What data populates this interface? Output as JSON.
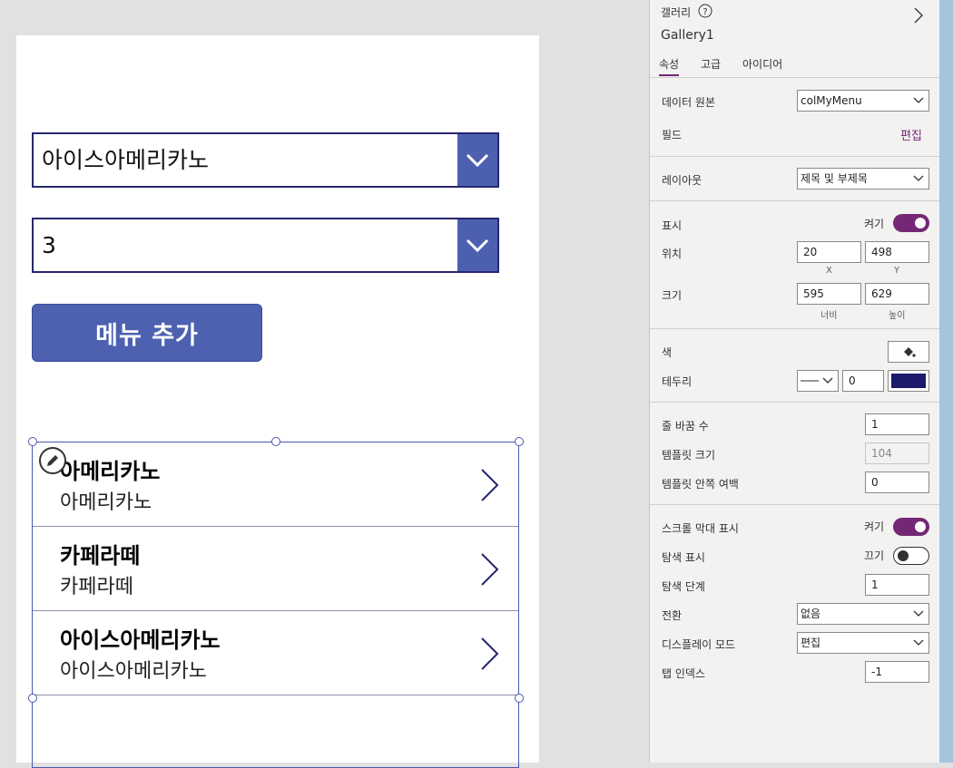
{
  "canvas": {
    "dropdown1_value": "아이스아메리카노",
    "dropdown2_value": "3",
    "add_button_label": "메뉴 추가"
  },
  "gallery": {
    "items": [
      {
        "title": "아메리카노",
        "subtitle": "아메리카노"
      },
      {
        "title": "카페라떼",
        "subtitle": "카페라떼"
      },
      {
        "title": "아이스아메리카노",
        "subtitle": "아이스아메리카노"
      }
    ]
  },
  "panel": {
    "type_label": "갤러리",
    "control_name": "Gallery1",
    "tabs": [
      "속성",
      "고급",
      "아이디어"
    ],
    "data_source_label": "데이터 원본",
    "data_source_value": "colMyMenu",
    "fields_label": "필드",
    "fields_edit": "편집",
    "layout_label": "레이아웃",
    "layout_value": "제목 및 부제목",
    "visible_label": "표시",
    "visible_state": "켜기",
    "position_label": "위치",
    "pos_x": "20",
    "pos_y": "498",
    "x_caption": "X",
    "y_caption": "Y",
    "size_label": "크기",
    "width": "595",
    "height": "629",
    "width_caption": "너비",
    "height_caption": "높이",
    "color_label": "색",
    "border_label": "테두리",
    "border_width": "0",
    "border_color": "#1b1a6b",
    "wrap_label": "줄 바꿈 수",
    "wrap_value": "1",
    "template_size_label": "템플릿 크기",
    "template_size_value": "104",
    "template_padding_label": "템플릿 안쪽 여백",
    "template_padding_value": "0",
    "scrollbar_label": "스크롤 막대 표시",
    "scrollbar_state": "켜기",
    "nav_label": "탐색 표시",
    "nav_state": "끄기",
    "nav_step_label": "탐색 단계",
    "nav_step_value": "1",
    "transition_label": "전환",
    "transition_value": "없음",
    "display_mode_label": "디스플레이 모드",
    "display_mode_value": "편집",
    "tab_index_label": "탭 인덱스",
    "tab_index_value": "-1"
  },
  "colors": {
    "accent": "#742774",
    "dropdown_chevron_bg": "#4d60b0",
    "button_bg": "#4d61b0",
    "gallery_arrow": "#25276d"
  }
}
